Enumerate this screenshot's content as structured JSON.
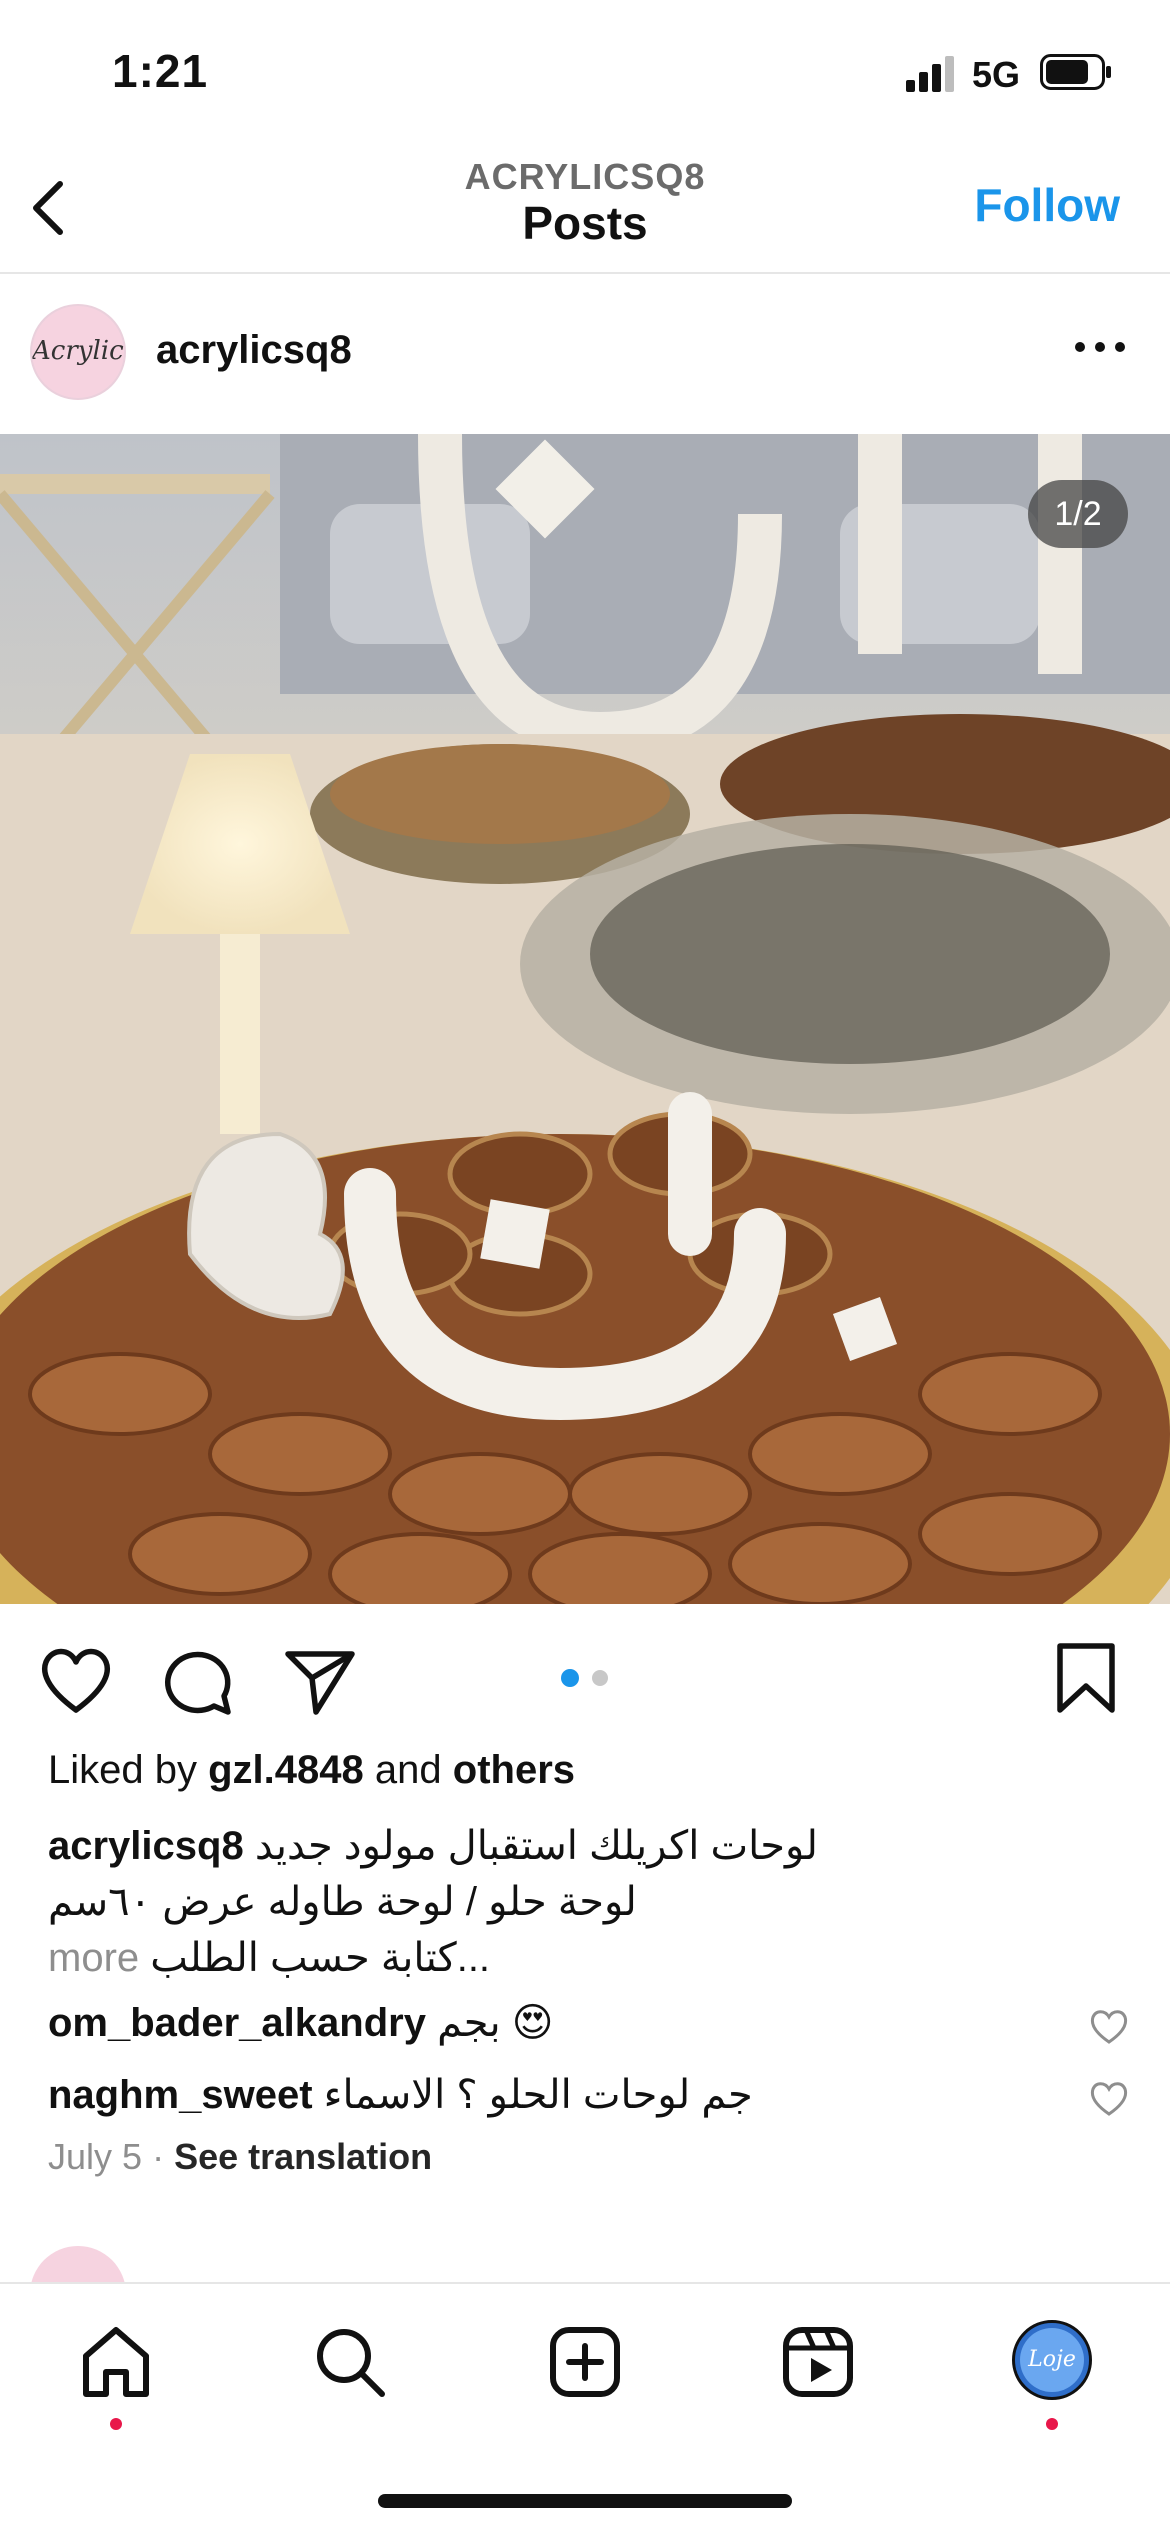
{
  "status_bar": {
    "time": "1:21",
    "network": "5G"
  },
  "nav": {
    "subtitle": "ACRYLICSQ8",
    "title": "Posts",
    "follow_label": "Follow",
    "accent_color": "#1a95ea"
  },
  "post": {
    "avatar_text": "Acrylics",
    "username": "acrylicsq8",
    "photo_counter": "1/2",
    "liked_prefix": "Liked by",
    "liked_user": "gzl.4848",
    "liked_and": "and",
    "liked_others": "others",
    "caption_user": "acrylicsq8",
    "caption_lines": [
      "لوحات اكريلك استقبال مولود جديد",
      "لوحة حلو / لوحة طاوله عرض ٦٠سم",
      "كتابة حسب الطلب..."
    ],
    "caption_more": "more",
    "comments": [
      {
        "user": "om_bader_alkandry",
        "text": "بجم 😍"
      },
      {
        "user": "naghm_sweet",
        "text": "جم لوحات الحلو ؟ الاسماء"
      }
    ],
    "date": "July 5",
    "separator": "·",
    "see_translation": "See translation"
  },
  "tabbar": {
    "profile_avatar_text": "Loje",
    "notification_color": "#e8174a"
  }
}
